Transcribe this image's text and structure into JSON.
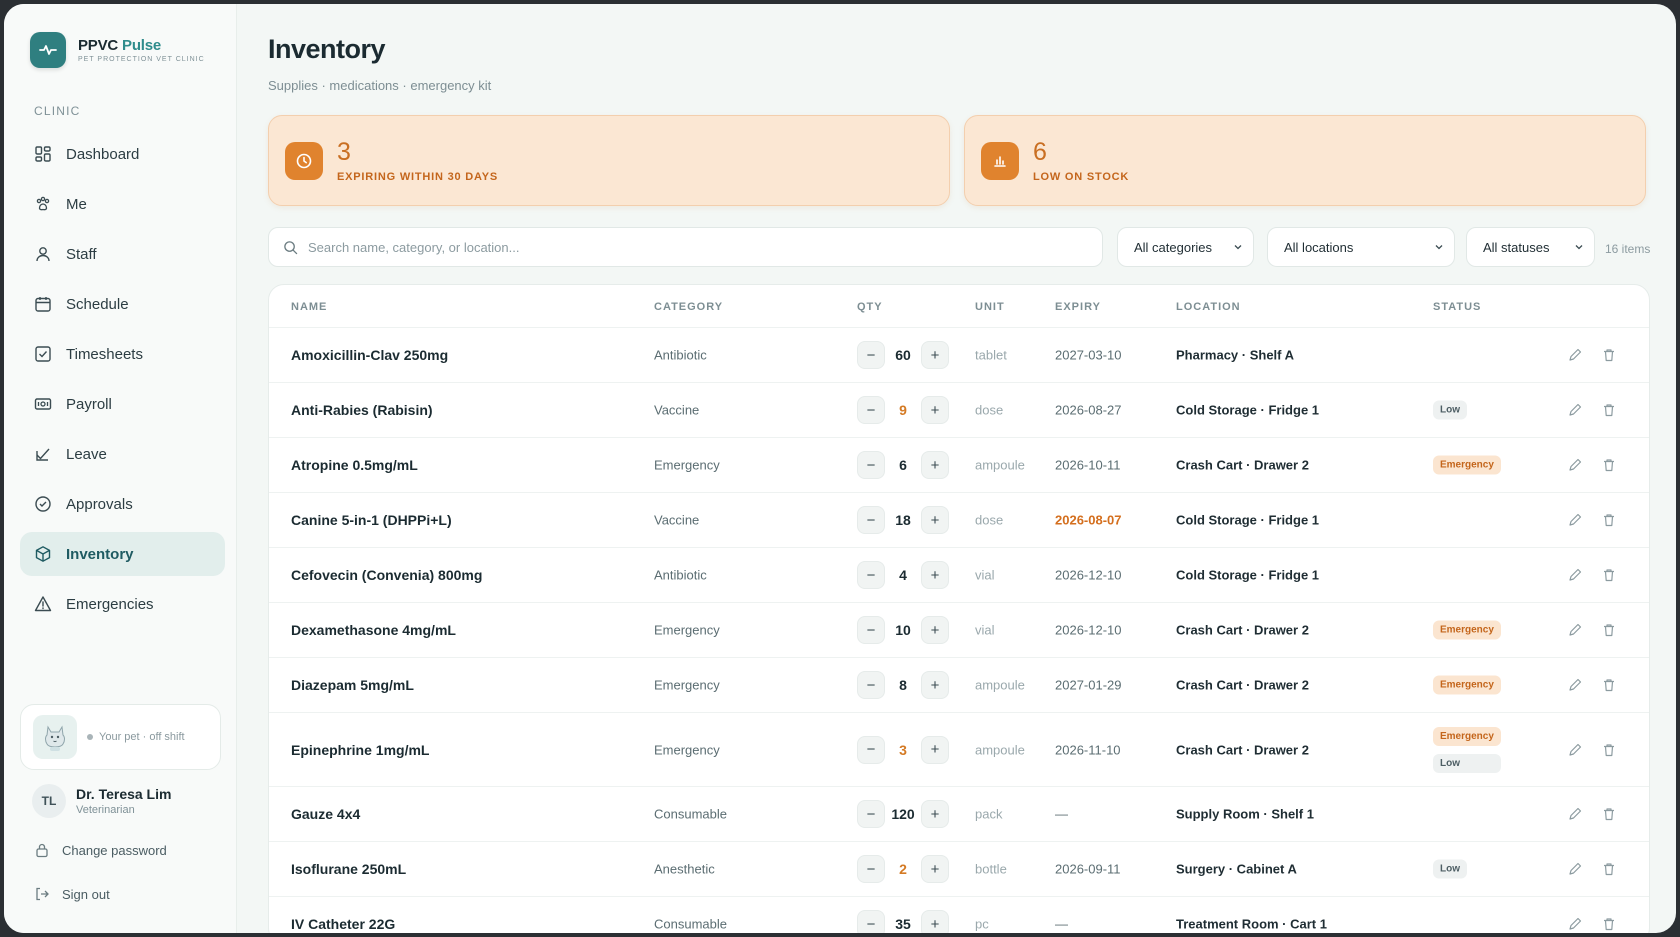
{
  "brand": {
    "name_part1": "PPVC",
    "name_part2": "Pulse",
    "subtitle": "PET PROTECTION VET CLINIC"
  },
  "sidebar": {
    "section_label": "CLINIC",
    "items": [
      {
        "label": "Dashboard",
        "icon": "dashboard-icon"
      },
      {
        "label": "Me",
        "icon": "paw-icon"
      },
      {
        "label": "Staff",
        "icon": "person-icon"
      },
      {
        "label": "Schedule",
        "icon": "calendar-icon"
      },
      {
        "label": "Timesheets",
        "icon": "checkbox-icon"
      },
      {
        "label": "Payroll",
        "icon": "money-icon"
      },
      {
        "label": "Leave",
        "icon": "leave-icon"
      },
      {
        "label": "Approvals",
        "icon": "check-circle-icon"
      },
      {
        "label": "Inventory",
        "icon": "box-icon",
        "active": true
      },
      {
        "label": "Emergencies",
        "icon": "warning-icon"
      }
    ],
    "pet_status": "Your pet · off shift",
    "user": {
      "initials": "TL",
      "name": "Dr. Teresa Lim",
      "role": "Veterinarian"
    },
    "change_password": "Change password",
    "sign_out": "Sign out"
  },
  "page": {
    "title": "Inventory",
    "subtitle": "Supplies · medications · emergency kit"
  },
  "stats": [
    {
      "value": "3",
      "label": "EXPIRING WITHIN 30 DAYS",
      "icon": "clock-icon"
    },
    {
      "value": "6",
      "label": "LOW ON STOCK",
      "icon": "bar-chart-icon"
    }
  ],
  "filters": {
    "search_placeholder": "Search name, category, or location...",
    "category": "All categories",
    "location": "All locations",
    "status": "All statuses",
    "count": "16 items"
  },
  "table": {
    "headers": [
      "NAME",
      "CATEGORY",
      "QTY",
      "UNIT",
      "EXPIRY",
      "LOCATION",
      "STATUS"
    ],
    "rows": [
      {
        "name": "Amoxicillin-Clav 250mg",
        "category": "Antibiotic",
        "qty": "60",
        "unit": "tablet",
        "expiry": "2027-03-10",
        "location": "Pharmacy · Shelf A",
        "badges": []
      },
      {
        "name": "Anti-Rabies (Rabisin)",
        "category": "Vaccine",
        "qty": "9",
        "unit": "dose",
        "expiry": "2026-08-27",
        "location": "Cold Storage · Fridge 1",
        "badges": [
          "Low"
        ],
        "low": true
      },
      {
        "name": "Atropine 0.5mg/mL",
        "category": "Emergency",
        "qty": "6",
        "unit": "ampoule",
        "expiry": "2026-10-11",
        "location": "Crash Cart · Drawer 2",
        "badges": [
          "Emergency"
        ]
      },
      {
        "name": "Canine 5-in-1 (DHPPi+L)",
        "category": "Vaccine",
        "qty": "18",
        "unit": "dose",
        "expiry": "2026-08-07",
        "location": "Cold Storage · Fridge 1",
        "badges": [],
        "expiring": true
      },
      {
        "name": "Cefovecin (Convenia) 800mg",
        "category": "Antibiotic",
        "qty": "4",
        "unit": "vial",
        "expiry": "2026-12-10",
        "location": "Cold Storage · Fridge 1",
        "badges": []
      },
      {
        "name": "Dexamethasone 4mg/mL",
        "category": "Emergency",
        "qty": "10",
        "unit": "vial",
        "expiry": "2026-12-10",
        "location": "Crash Cart · Drawer 2",
        "badges": [
          "Emergency"
        ]
      },
      {
        "name": "Diazepam 5mg/mL",
        "category": "Emergency",
        "qty": "8",
        "unit": "ampoule",
        "expiry": "2027-01-29",
        "location": "Crash Cart · Drawer 2",
        "badges": [
          "Emergency"
        ]
      },
      {
        "name": "Epinephrine 1mg/mL",
        "category": "Emergency",
        "qty": "3",
        "unit": "ampoule",
        "expiry": "2026-11-10",
        "location": "Crash Cart · Drawer 2",
        "badges": [
          "Emergency",
          "Low"
        ],
        "low": true
      },
      {
        "name": "Gauze 4x4",
        "category": "Consumable",
        "qty": "120",
        "unit": "pack",
        "expiry": "—",
        "location": "Supply Room · Shelf 1",
        "badges": []
      },
      {
        "name": "Isoflurane 250mL",
        "category": "Anesthetic",
        "qty": "2",
        "unit": "bottle",
        "expiry": "2026-09-11",
        "location": "Surgery · Cabinet A",
        "badges": [
          "Low"
        ],
        "low": true
      },
      {
        "name": "IV Catheter 22G",
        "category": "Consumable",
        "qty": "35",
        "unit": "pc",
        "expiry": "—",
        "location": "Treatment Room · Cart 1",
        "badges": []
      }
    ]
  },
  "colors": {
    "accent": "#2f7f80",
    "warning": "#e0832e",
    "background": "#f3f7f5"
  }
}
